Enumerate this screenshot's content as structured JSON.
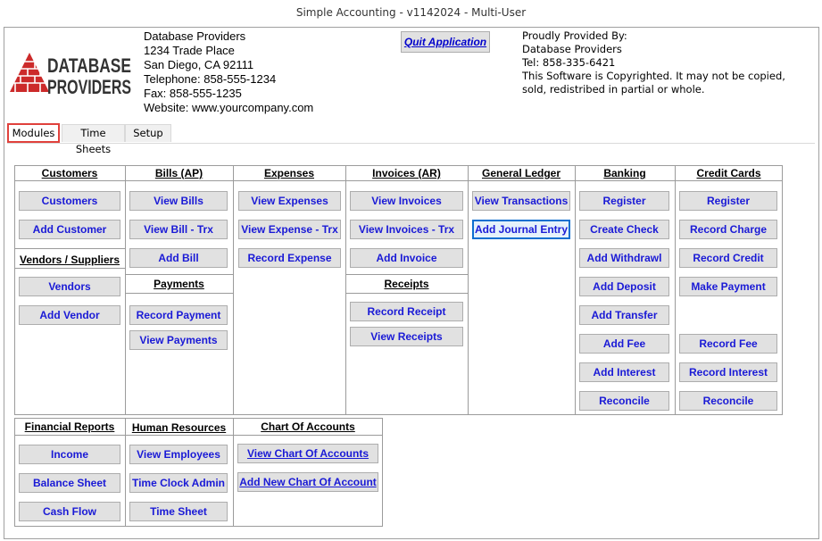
{
  "window": {
    "title": "Simple Accounting - v1142024 - Multi-User"
  },
  "company": {
    "logo_text_top": "DATABASE",
    "logo_text_bottom": "PROVIDERS",
    "name": "Database Providers",
    "address1": "1234 Trade Place",
    "address2": "San Diego, CA  92111",
    "telephone": "Telephone: 858-555-1234",
    "fax": "Fax: 858-555-1235",
    "website": "Website: www.yourcompany.com"
  },
  "quit_label": "Quit Application",
  "provided": {
    "line1": "Proudly Provided By:",
    "line2": "Database Providers",
    "line3": "Tel: 858-335-6421",
    "line4": "This Software is Copyrighted. It may not be copied,",
    "line5": "sold, redistribed in partial or whole."
  },
  "tabs": {
    "modules": "Modules",
    "timesheets": "Time Sheets",
    "setup": "Setup"
  },
  "customers": {
    "header": "Customers",
    "btn1": "Customers",
    "btn2": "Add Customer",
    "header2": "Vendors / Suppliers",
    "btn3": "Vendors",
    "btn4": "Add Vendor"
  },
  "bills": {
    "header": "Bills (AP)",
    "btn1": "View Bills",
    "btn2": "View Bill - Trx",
    "btn3": "Add Bill",
    "header2": "Payments",
    "btn4": "Record Payment",
    "btn5": "View Payments"
  },
  "expenses": {
    "header": "Expenses",
    "btn1": "View Expenses",
    "btn2": "View Expense - Trx",
    "btn3": "Record Expense"
  },
  "invoices": {
    "header": "Invoices (AR)",
    "btn1": "View Invoices",
    "btn2": "View Invoices - Trx",
    "btn3": "Add Invoice",
    "header2": "Receipts",
    "btn4": "Record Receipt",
    "btn5": "View Receipts"
  },
  "ledger": {
    "header": "General Ledger",
    "btn1": "View Transactions",
    "btn2": "Add Journal Entry"
  },
  "banking": {
    "header": "Banking",
    "btn1": "Register",
    "btn2": "Create Check",
    "btn3": "Add Withdrawl",
    "btn4": "Add Deposit",
    "btn5": "Add Transfer",
    "btn6": "Add Fee",
    "btn7": "Add Interest",
    "btn8": "Reconcile"
  },
  "credit": {
    "header": "Credit Cards",
    "btn1": "Register",
    "btn2": "Record Charge",
    "btn3": "Record Credit",
    "btn4": "Make Payment",
    "btn5": "Record Fee",
    "btn6": "Record Interest",
    "btn7": "Reconcile"
  },
  "financial": {
    "header": "Financial Reports",
    "btn1": "Income",
    "btn2": "Balance Sheet",
    "btn3": "Cash Flow"
  },
  "hr": {
    "header": "Human Resources",
    "btn1": "View Employees",
    "btn2": "Time Clock Admin",
    "btn3": "Time Sheet"
  },
  "coa": {
    "header": "Chart Of Accounts",
    "btn1": "View Chart Of Accounts",
    "btn2": "Add New Chart Of Account"
  },
  "colors": {
    "button_text": "#1a1ad6",
    "active_tab_border": "#e0413c",
    "focus_border": "#0b6fd0",
    "logo_red": "#cc2a2a"
  }
}
